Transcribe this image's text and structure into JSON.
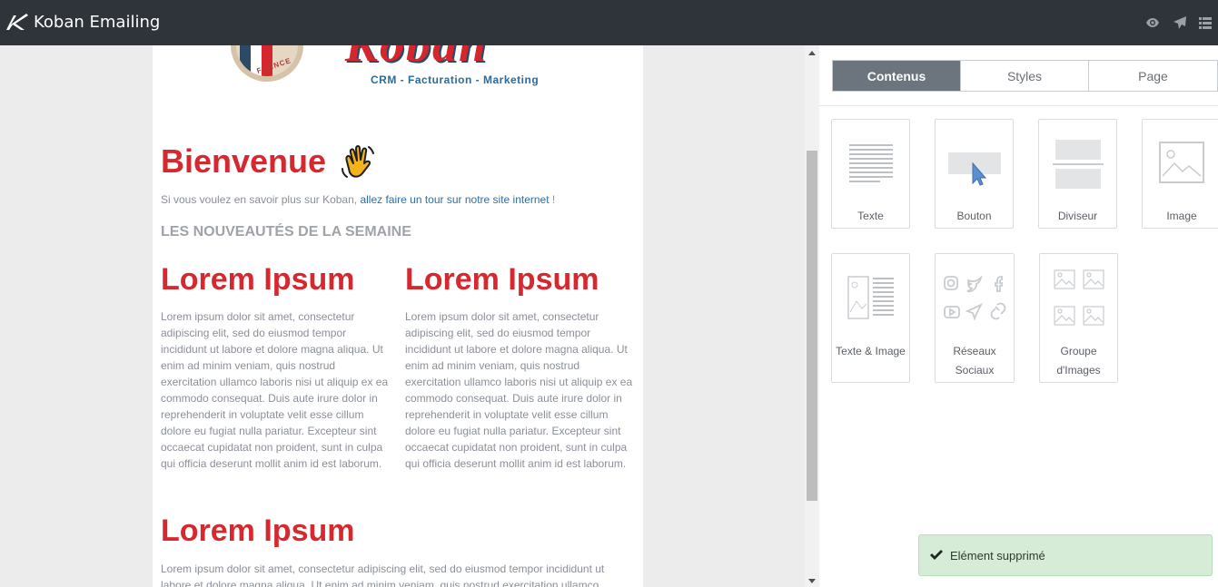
{
  "app": {
    "title": "Koban Emailing"
  },
  "topbar": {
    "icons": [
      "eye-icon",
      "send-icon",
      "menu-icon"
    ]
  },
  "email": {
    "brand": {
      "name": "Koban",
      "country": "FRANCE",
      "tagline": "CRM - Facturation - Marketing"
    },
    "welcome": "Bienvenue",
    "intro_prefix": "Si vous voulez en savoir plus sur Koban, ",
    "intro_link": "allez faire un tour sur notre site internet",
    "intro_suffix": " !",
    "news_title": "LES NOUVEAUTÉS DE LA SEMAINE",
    "columns": [
      {
        "title": "Lorem Ipsum",
        "text": "Lorem ipsum dolor sit amet, consectetur adipiscing elit, sed do eiusmod tempor incididunt ut labore et dolore magna aliqua. Ut enim ad minim veniam, quis nostrud exercitation ullamco laboris nisi ut aliquip ex ea commodo consequat. Duis aute irure dolor in reprehenderit in voluptate velit esse cillum dolore eu fugiat nulla pariatur. Excepteur sint occaecat cupidatat non proident, sunt in culpa qui officia deserunt mollit anim id est laborum."
      },
      {
        "title": "Lorem Ipsum",
        "text": "Lorem ipsum dolor sit amet, consectetur adipiscing elit, sed do eiusmod tempor incididunt ut labore et dolore magna aliqua. Ut enim ad minim veniam, quis nostrud exercitation ullamco laboris nisi ut aliquip ex ea commodo consequat. Duis aute irure dolor in reprehenderit in voluptate velit esse cillum dolore eu fugiat nulla pariatur. Excepteur sint occaecat cupidatat non proident, sunt in culpa qui officia deserunt mollit anim id est laborum."
      }
    ],
    "section3": {
      "title": "Lorem Ipsum",
      "text": "Lorem ipsum dolor sit amet, consectetur adipiscing elit, sed do eiusmod tempor incididunt ut labore et dolore magna aliqua. Ut enim ad minim veniam, quis nostrud exercitation ullamco"
    }
  },
  "panel": {
    "tabs": [
      {
        "label": "Contenus",
        "active": true
      },
      {
        "label": "Styles",
        "active": false
      },
      {
        "label": "Page",
        "active": false
      }
    ],
    "blocks": [
      {
        "label": "Texte",
        "icon": "text-block-icon"
      },
      {
        "label": "Bouton",
        "icon": "button-block-icon"
      },
      {
        "label": "Diviseur",
        "icon": "divider-block-icon"
      },
      {
        "label": "Image",
        "icon": "image-block-icon"
      },
      {
        "label": "Texte & Image",
        "icon": "text-image-block-icon"
      },
      {
        "label": "Réseaux Sociaux",
        "icon": "social-block-icon"
      },
      {
        "label": "Groupe d'Images",
        "icon": "image-group-block-icon"
      }
    ]
  },
  "toast": {
    "message": "Elément supprimé",
    "icon": "check-icon"
  },
  "colors": {
    "topbar": "#2f343b",
    "accent_red": "#d8282f",
    "link": "#2e6da4",
    "active_tab": "#6c747d",
    "toast_bg": "#d6ecd7"
  }
}
